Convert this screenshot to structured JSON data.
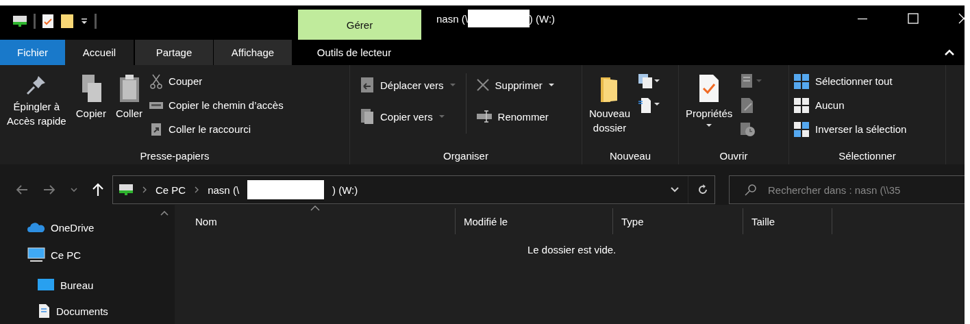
{
  "window": {
    "title_start": "nasn (\\",
    "title_end": ") (W:)"
  },
  "contextual": {
    "group": "Gérer"
  },
  "tabs": [
    {
      "label": "Fichier",
      "kind": "file",
      "selected": false
    },
    {
      "label": "Accueil",
      "kind": "tab",
      "selected": true
    },
    {
      "label": "Partage",
      "kind": "tab",
      "selected": false
    },
    {
      "label": "Affichage",
      "kind": "tab",
      "selected": false
    },
    {
      "label": "Outils de lecteur",
      "kind": "contextual",
      "selected": false
    }
  ],
  "ribbon": {
    "groups": [
      {
        "label": "Presse-papiers",
        "large": [
          "Épingler à\nAccès rapide",
          "Copier",
          "Coller"
        ],
        "small": [
          "Couper",
          "Copier le chemin d’accès",
          "Coller le raccourci"
        ]
      },
      {
        "label": "Organiser",
        "small": [
          "Déplacer vers",
          "Copier vers",
          "Supprimer",
          "Renommer"
        ]
      },
      {
        "label": "Nouveau",
        "large": [
          "Nouveau\ndossier"
        ]
      },
      {
        "label": "Ouvrir",
        "large": [
          "Propriétés"
        ]
      },
      {
        "label": "Sélectionner",
        "small": [
          "Sélectionner tout",
          "Aucun",
          "Inverser la sélection"
        ]
      }
    ]
  },
  "address": {
    "crumbs": [
      "Ce PC",
      "nasn (\\"
    ],
    "crumb_end": ") (W:)",
    "search_placeholder": "Rechercher dans : nasn (\\\\35"
  },
  "sidebar": {
    "items": [
      {
        "label": "OneDrive"
      },
      {
        "label": "Ce PC",
        "children": [
          {
            "label": "Bureau"
          },
          {
            "label": "Documents"
          }
        ]
      }
    ]
  },
  "table": {
    "columns": [
      {
        "label": "Nom",
        "sorted": true
      },
      {
        "label": "Modifié le",
        "sorted": false
      },
      {
        "label": "Type",
        "sorted": false
      },
      {
        "label": "Taille",
        "sorted": false
      }
    ],
    "empty_message": "Le dossier est vide."
  }
}
